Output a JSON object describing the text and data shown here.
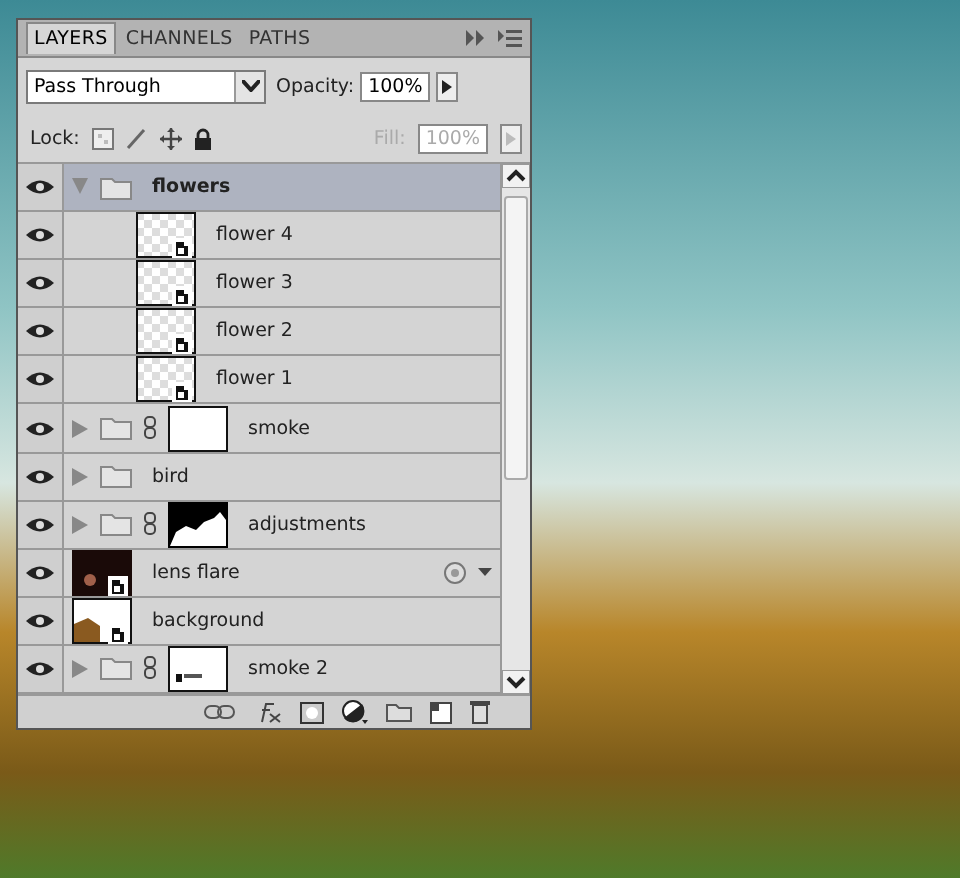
{
  "panel": {
    "tabs": [
      {
        "label": "LAYERS",
        "selected": true
      },
      {
        "label": "CHANNELS",
        "selected": false
      },
      {
        "label": "PATHS",
        "selected": false
      }
    ],
    "blend_mode": "Pass Through",
    "opacity_label": "Opacity:",
    "opacity": "100%",
    "lock_label": "Lock:",
    "fill_label": "Fill:",
    "fill": "100%",
    "fill_disabled": true,
    "layers": [
      {
        "kind": "group",
        "name": "flowers",
        "visible": true,
        "selected": true,
        "expanded": true,
        "children": [
          {
            "kind": "smart",
            "name": "flower 4",
            "visible": true,
            "selected": false,
            "thumbnail": {
              "kind": "transparent"
            }
          },
          {
            "kind": "smart",
            "name": "flower 3",
            "visible": true,
            "selected": false,
            "thumbnail": {
              "kind": "transparent"
            }
          },
          {
            "kind": "smart",
            "name": "flower 2",
            "visible": true,
            "selected": false,
            "thumbnail": {
              "kind": "transparent"
            }
          },
          {
            "kind": "smart",
            "name": "flower 1",
            "visible": true,
            "selected": false,
            "thumbnail": {
              "kind": "transparent"
            }
          }
        ]
      },
      {
        "kind": "group",
        "name": "smoke",
        "visible": true,
        "selected": false,
        "expanded": false,
        "mask": {
          "kind": "white"
        }
      },
      {
        "kind": "group",
        "name": "bird",
        "visible": true,
        "selected": false,
        "expanded": false
      },
      {
        "kind": "group",
        "name": "adjustments",
        "visible": true,
        "selected": false,
        "expanded": false,
        "mask": {
          "kind": "hills"
        }
      },
      {
        "kind": "smart",
        "name": "lens flare",
        "visible": true,
        "selected": false,
        "thumbnail": {
          "kind": "dark"
        },
        "effects": true
      },
      {
        "kind": "smart",
        "name": "background",
        "visible": true,
        "selected": false,
        "thumbnail": {
          "kind": "photo"
        }
      },
      {
        "kind": "group",
        "name": "smoke 2",
        "visible": true,
        "selected": false,
        "expanded": false,
        "mask": {
          "kind": "streak"
        }
      }
    ]
  }
}
